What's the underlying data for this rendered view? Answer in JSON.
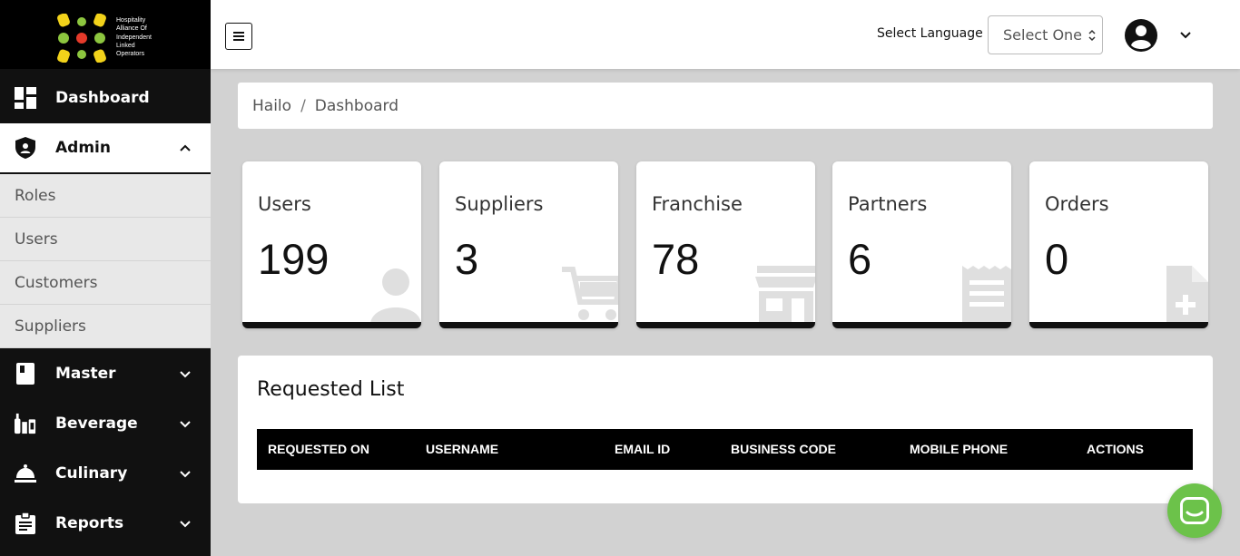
{
  "brand": {
    "logo_lines": [
      "Hospitality",
      "Alliance Of",
      "Independent",
      "Linked",
      "Operators"
    ],
    "dot_colors": [
      "#f2d21a",
      "#8dc63f",
      "#e53a2a"
    ]
  },
  "sidebar": {
    "dashboard": "Dashboard",
    "admin": "Admin",
    "admin_sub": [
      "Roles",
      "Users",
      "Customers",
      "Suppliers"
    ],
    "master": "Master",
    "beverage": "Beverage",
    "culinary": "Culinary",
    "reports": "Reports"
  },
  "topbar": {
    "menu_icon": "hamburger-icon",
    "language_label": "Select Language",
    "language_select": "Select One"
  },
  "breadcrumb": {
    "root": "Hailo",
    "sep": "/",
    "current": "Dashboard"
  },
  "stats": [
    {
      "label": "Users",
      "value": "199",
      "icon": "user-icon"
    },
    {
      "label": "Suppliers",
      "value": "3",
      "icon": "cart-icon"
    },
    {
      "label": "Franchise",
      "value": "78",
      "icon": "store-icon"
    },
    {
      "label": "Partners",
      "value": "6",
      "icon": "receipt-icon"
    },
    {
      "label": "Orders",
      "value": "0",
      "icon": "add-file-icon"
    }
  ],
  "requested_list": {
    "title": "Requested List",
    "columns": [
      "REQUESTED ON",
      "USERNAME",
      "EMAIL ID",
      "BUSINESS CODE",
      "MOBILE PHONE",
      "ACTIONS"
    ]
  },
  "colors": {
    "chat_button": "#6cc24a",
    "sidebar_bg": "#111111",
    "page_bg": "#d2d2d2"
  }
}
